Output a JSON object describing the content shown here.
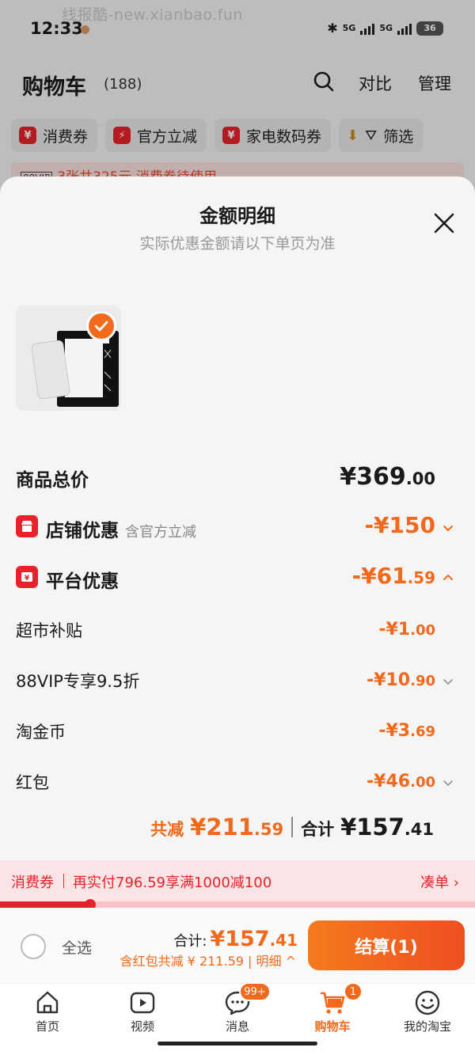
{
  "status_bar": {
    "time": "12:33",
    "watermark": "线报酷-new.xianbao.fun",
    "net1": "5G",
    "net2": "5G",
    "battery": "36"
  },
  "cart_header": {
    "title": "购物车",
    "count": "(188)",
    "compare": "对比",
    "manage": "管理"
  },
  "filters": [
    {
      "icon": "¥",
      "label": "消费券"
    },
    {
      "icon": "⚡",
      "label": "官方立减"
    },
    {
      "icon": "¥",
      "label": "家电数码券"
    },
    {
      "icon": "",
      "label": "筛选"
    }
  ],
  "banner": {
    "vip": "88VIP",
    "text": "3张共325元 消费券待使用"
  },
  "sheet": {
    "title": "金额明细",
    "subtitle": "实际优惠金额请以下单页为准",
    "rows": {
      "total_price": {
        "label": "商品总价",
        "int": "¥369",
        "dec": ".00"
      },
      "shop_discount": {
        "label": "店铺优惠",
        "note": "含官方立减",
        "int": "-¥150",
        "dec": ""
      },
      "platform_discount": {
        "label": "平台优惠",
        "int": "-¥61",
        "dec": ".59"
      },
      "supermarket": {
        "label": "超市补贴",
        "int": "-¥1",
        "dec": ".00"
      },
      "vip": {
        "label": "88VIP专享9.5折",
        "int": "-¥10",
        "dec": ".90"
      },
      "coins": {
        "label": "淘金币",
        "int": "-¥3",
        "dec": ".69"
      },
      "redpacket": {
        "label": "红包",
        "int": "-¥46",
        "dec": ".00"
      }
    },
    "summary": {
      "saved_label": "共减",
      "saved_int": "¥211",
      "saved_dec": ".59",
      "total_label": "合计",
      "total_int": "¥157",
      "total_dec": ".41"
    }
  },
  "coupon": {
    "tag": "消费券",
    "text": "再实付796.59享满1000减100",
    "link": "凑单 ›",
    "progress": 0.19
  },
  "checkout": {
    "select_all": "全选",
    "total_label": "合计:",
    "total_int": "¥157",
    "total_dec": ".41",
    "sub": "含红包共减 ¥ 211.59 | 明细 ^",
    "pay": "结算(1)"
  },
  "tabbar": [
    {
      "label": "首页",
      "icon": "home-icon"
    },
    {
      "label": "视频",
      "icon": "video-icon"
    },
    {
      "label": "消息",
      "icon": "message-icon",
      "badge": "99+"
    },
    {
      "label": "购物车",
      "icon": "cart-icon",
      "badge": "1",
      "active": true
    },
    {
      "label": "我的淘宝",
      "icon": "profile-icon"
    }
  ],
  "colors": {
    "accent": "#f2691c",
    "red": "#e8222a"
  }
}
